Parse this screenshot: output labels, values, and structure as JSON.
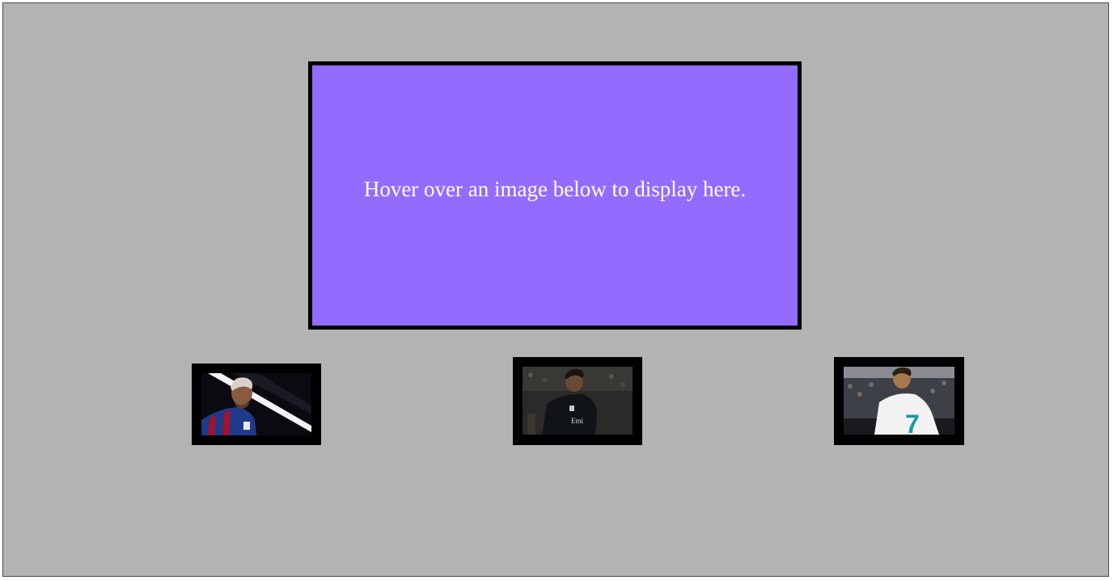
{
  "display": {
    "message": "Hover over an image below to display here.",
    "background_color": "#936cff",
    "border_color": "#000000",
    "text_color": "#ffffff"
  },
  "page": {
    "background_color": "#b3b3b3"
  },
  "thumbnails": [
    {
      "icon": "player-photo-icon",
      "jersey_text": ""
    },
    {
      "icon": "player-photo-icon",
      "jersey_text": "Emi"
    },
    {
      "icon": "player-photo-icon",
      "jersey_text": "7"
    }
  ]
}
